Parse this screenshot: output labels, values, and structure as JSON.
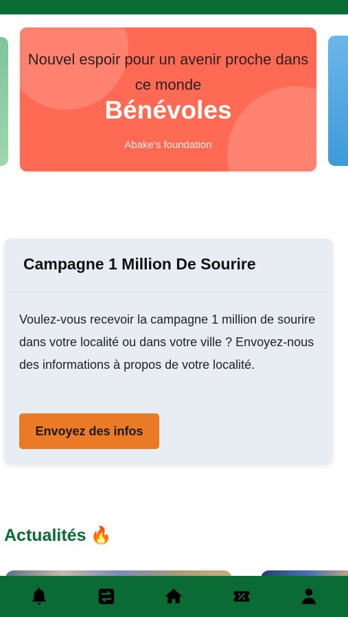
{
  "colors": {
    "brand_green": "#0a6b35",
    "slide_bg": "#ff6a55",
    "card_bg": "#e8edf3",
    "button_orange": "#ea7a26"
  },
  "carousel": {
    "slide": {
      "tagline": "Nouvel espoir pour un avenir proche dans ce monde",
      "title": "Bénévoles",
      "subtitle": "Abake's foundation"
    }
  },
  "campaign": {
    "title": "Campagne 1 Million De Sourire",
    "description": "Voulez-vous recevoir la campagne 1 million de sourire dans votre localité ou dans votre ville ? Envoyez-nous des informations à propos de votre localité.",
    "button_label": "Envoyez des infos"
  },
  "news": {
    "heading": "Actualités",
    "heading_icon": "🔥"
  },
  "bottom_nav": {
    "items": [
      {
        "icon": "bell-icon"
      },
      {
        "icon": "transfer-icon"
      },
      {
        "icon": "home-icon"
      },
      {
        "icon": "discount-ticket-icon"
      },
      {
        "icon": "user-icon"
      }
    ]
  }
}
